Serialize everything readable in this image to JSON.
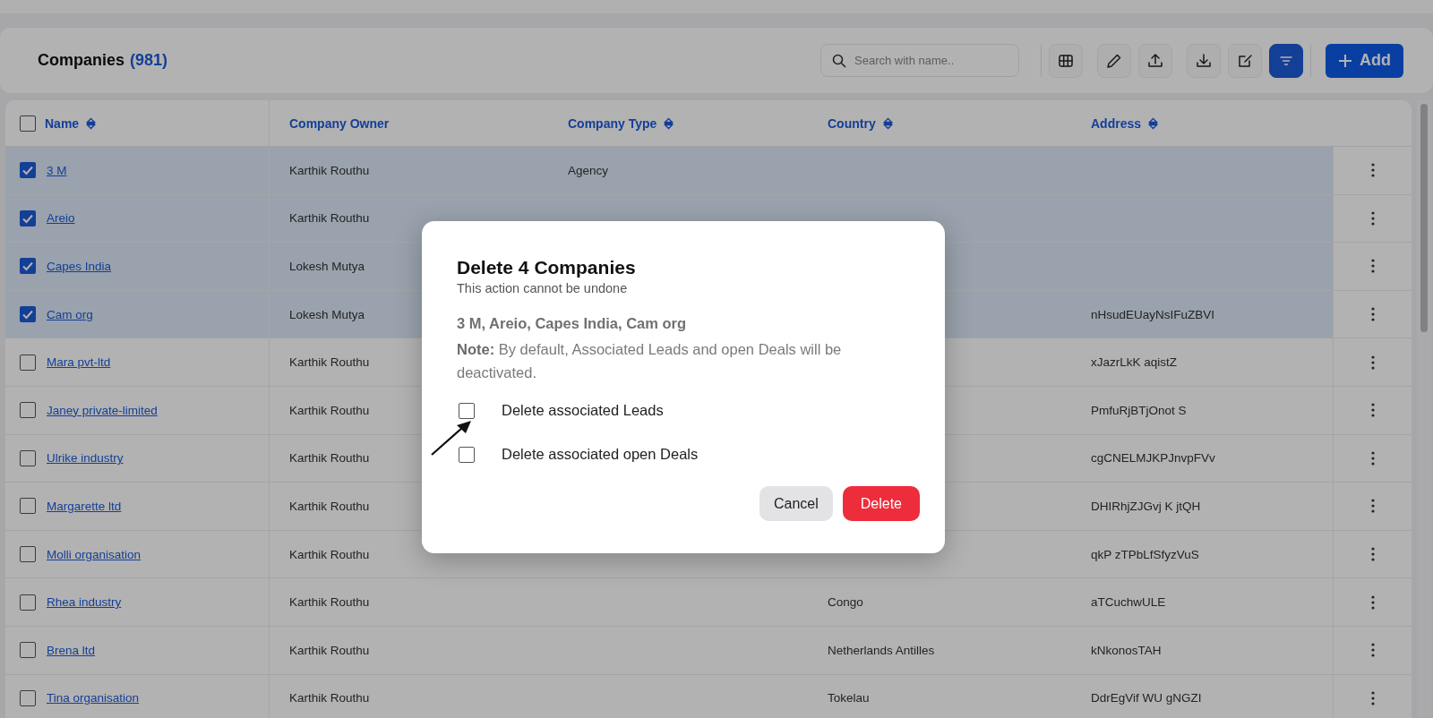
{
  "header": {
    "title": "Companies",
    "count": "(981)",
    "search": {
      "placeholder": "Search with name.."
    },
    "tools": [
      {
        "active": false
      },
      {
        "active": false
      },
      {
        "active": false
      },
      {
        "active": false
      },
      {
        "active": false
      },
      {
        "active": true
      }
    ],
    "add_button": "Add"
  },
  "table": {
    "select_all": {
      "checked": false
    },
    "columns": [
      {
        "label": "Name",
        "sortable": true
      },
      {
        "label": "Company Owner",
        "sortable": false
      },
      {
        "label": "Company Type",
        "sortable": true
      },
      {
        "label": "Country",
        "sortable": true
      },
      {
        "label": "Address",
        "sortable": true
      }
    ],
    "rows": [
      {
        "selected": true,
        "name": "3 M",
        "owner": "Karthik Routhu",
        "type": "Agency"
      },
      {
        "selected": true,
        "name": "Areio",
        "owner": "Karthik Routhu"
      },
      {
        "selected": true,
        "name": "Capes India",
        "owner": "Lokesh Mutya"
      },
      {
        "selected": true,
        "name": "Cam org",
        "owner": "Lokesh Mutya",
        "address": "nHsudEUayNsIFuZBVI"
      },
      {
        "selected": false,
        "name": "Mara pvt-ltd",
        "owner": "Karthik Routhu",
        "address": "xJazrLkK aqistZ"
      },
      {
        "selected": false,
        "name": "Janey private-limited",
        "owner": "Karthik Routhu",
        "address": "PmfuRjBTjOnot S"
      },
      {
        "selected": false,
        "name": "Ulrike industry",
        "owner": "Karthik Routhu",
        "address": "cgCNELMJKPJnvpFVv"
      },
      {
        "selected": false,
        "name": "Margarette ltd",
        "owner": "Karthik Routhu",
        "address": "DHIRhjZJGvj K jtQH"
      },
      {
        "selected": false,
        "name": "Molli organisation",
        "owner": "Karthik Routhu",
        "address": "qkP zTPbLfSfyzVuS"
      },
      {
        "selected": false,
        "name": "Rhea industry",
        "owner": "Karthik Routhu",
        "country": "Congo",
        "address": "aTCuchwULE"
      },
      {
        "selected": false,
        "name": "Brena ltd",
        "owner": "Karthik Routhu",
        "country": "Netherlands Antilles",
        "address": "kNkonosTAH"
      },
      {
        "selected": false,
        "name": "Tina organisation",
        "owner": "Karthik Routhu",
        "country": "Tokelau",
        "address": "DdrEgVif WU gNGZI"
      }
    ]
  },
  "dialog": {
    "title": "Delete 4 Companies",
    "subtitle": "This action cannot be undone",
    "names": "3 M, Areio, Capes India, Cam org",
    "note": "**Note:** By default, Associated Leads and open Deals will be deactivated.",
    "options": [
      {
        "label": "Delete associated Leads",
        "checked": false
      },
      {
        "label": "Delete associated open Deals",
        "checked": false
      }
    ],
    "cancel": "Cancel",
    "confirm": "Delete"
  }
}
